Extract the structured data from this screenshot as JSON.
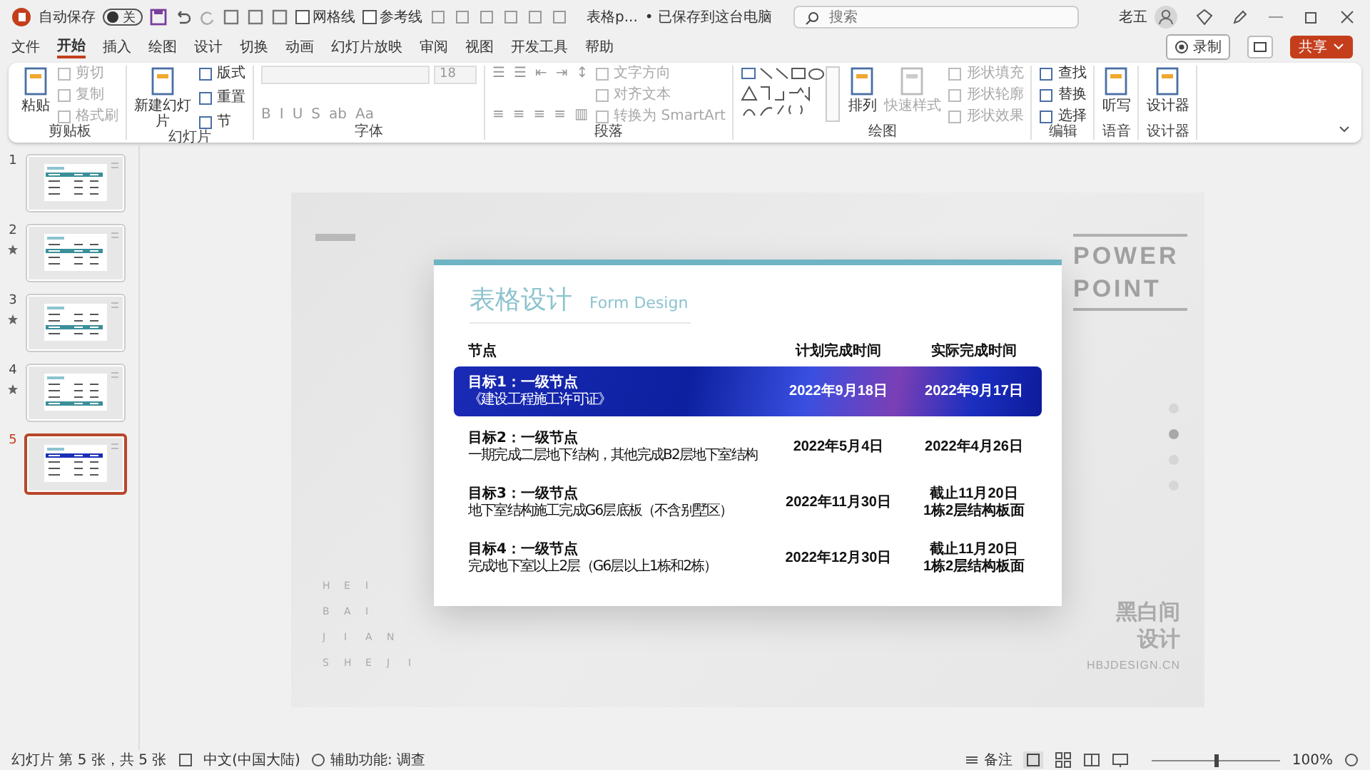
{
  "title_bar": {
    "autosave_label": "自动保存",
    "autosave_state": "关",
    "autosave_on": false,
    "quick_checks": [
      {
        "label": "网格线",
        "checked": false
      },
      {
        "label": "参考线",
        "checked": false
      }
    ],
    "file_name": "表格p...",
    "save_status": "• 已保存到这台电脑",
    "search": {
      "placeholder": "搜索"
    },
    "user_name": "老五"
  },
  "ribbon_tabs": [
    {
      "label": "文件",
      "selected": false
    },
    {
      "label": "开始",
      "selected": true
    },
    {
      "label": "插入",
      "selected": false
    },
    {
      "label": "绘图",
      "selected": false
    },
    {
      "label": "设计",
      "selected": false
    },
    {
      "label": "切换",
      "selected": false
    },
    {
      "label": "动画",
      "selected": false
    },
    {
      "label": "幻灯片放映",
      "selected": false
    },
    {
      "label": "审阅",
      "selected": false
    },
    {
      "label": "视图",
      "selected": false
    },
    {
      "label": "开发工具",
      "selected": false
    },
    {
      "label": "帮助",
      "selected": false
    }
  ],
  "top_actions": {
    "record": "录制",
    "share": "共享"
  },
  "ribbon_groups": [
    {
      "title": "剪贴板",
      "columns": [
        [
          {
            "kind": "large",
            "label": "粘贴",
            "disabled": false
          }
        ],
        [
          {
            "kind": "small",
            "label": "剪切",
            "disabled": true
          },
          {
            "kind": "small",
            "label": "复制",
            "disabled": true
          },
          {
            "kind": "small",
            "label": "格式刷",
            "disabled": true
          }
        ]
      ]
    },
    {
      "title": "幻灯片",
      "columns": [
        [
          {
            "kind": "large",
            "label": "新建幻灯片",
            "disabled": false
          }
        ],
        [
          {
            "kind": "small",
            "label": "版式",
            "disabled": false
          },
          {
            "kind": "small",
            "label": "重置",
            "disabled": false
          },
          {
            "kind": "small",
            "label": "节",
            "disabled": false
          }
        ]
      ]
    },
    {
      "title": "字体",
      "columns": [
        [
          {
            "kind": "combo",
            "label": "18",
            "disabled": true
          },
          {
            "kind": "glyphs",
            "labels": [
              "B",
              "I",
              "U",
              "S",
              "ab",
              "Aa"
            ],
            "disabled": true
          }
        ]
      ]
    },
    {
      "title": "段落",
      "columns": [
        [
          {
            "kind": "glyphs",
            "labels": [
              "☰",
              "☰",
              "⇤",
              "⇥",
              "↕"
            ],
            "disabled": true
          },
          {
            "kind": "glyphs",
            "labels": [
              "≡",
              "≡",
              "≡",
              "≡",
              "▥"
            ],
            "disabled": true
          }
        ],
        [
          {
            "kind": "small",
            "label": "文字方向",
            "disabled": true
          },
          {
            "kind": "small",
            "label": "对齐文本",
            "disabled": true
          },
          {
            "kind": "small",
            "label": "转换为 SmartArt",
            "disabled": true
          }
        ]
      ]
    },
    {
      "title": "绘图",
      "columns": [
        [
          {
            "kind": "shapes"
          }
        ],
        [
          {
            "kind": "large",
            "label": "排列",
            "disabled": false
          }
        ],
        [
          {
            "kind": "large",
            "label": "快速样式",
            "disabled": true
          }
        ],
        [
          {
            "kind": "small",
            "label": "形状填充",
            "disabled": true
          },
          {
            "kind": "small",
            "label": "形状轮廓",
            "disabled": true
          },
          {
            "kind": "small",
            "label": "形状效果",
            "disabled": true
          }
        ]
      ]
    },
    {
      "title": "编辑",
      "columns": [
        [
          {
            "kind": "small",
            "label": "查找",
            "disabled": false
          },
          {
            "kind": "small",
            "label": "替换",
            "disabled": false
          },
          {
            "kind": "small",
            "label": "选择",
            "disabled": false
          }
        ]
      ]
    },
    {
      "title": "语音",
      "columns": [
        [
          {
            "kind": "large",
            "label": "听写",
            "disabled": false
          }
        ]
      ]
    },
    {
      "title": "设计器",
      "columns": [
        [
          {
            "kind": "large",
            "label": "设计器",
            "disabled": false
          }
        ]
      ]
    }
  ],
  "slides": [
    {
      "number": "1",
      "selected": false,
      "animated": false
    },
    {
      "number": "2",
      "selected": false,
      "animated": true
    },
    {
      "number": "3",
      "selected": false,
      "animated": true
    },
    {
      "number": "4",
      "selected": false,
      "animated": true
    },
    {
      "number": "5",
      "selected": true,
      "animated": false
    }
  ],
  "slide": {
    "heading": "表格设计",
    "subheading": "Form Design",
    "columns": [
      "节点",
      "计划完成时间",
      "实际完成时间"
    ],
    "rows": [
      {
        "title": "目标1：一级节点",
        "detail": "《建设工程施工许可证》",
        "planned": "2022年9月18日",
        "actual": [
          "2022年9月17日"
        ],
        "highlighted": true
      },
      {
        "title": "目标2：一级节点",
        "detail": "一期完成二层地下结构，其他完成B2层地下室结构",
        "planned": "2022年5月4日",
        "actual": [
          "2022年4月26日"
        ],
        "highlighted": false
      },
      {
        "title": "目标3：一级节点",
        "detail": "地下室结构施工完成G6层底板（不含别墅区）",
        "planned": "2022年11月30日",
        "actual": [
          "截止11月20日",
          "1栋2层结构板面"
        ],
        "highlighted": false
      },
      {
        "title": "目标4：一级节点",
        "detail": "完成地下室以上2层（G6层以上1栋和2栋）",
        "planned": "2022年12月30日",
        "actual": [
          "截止11月20日",
          "1栋2层结构板面"
        ],
        "highlighted": false
      }
    ],
    "side_title": [
      "POWER",
      "POINT"
    ],
    "brand": [
      "黑白间",
      "设计"
    ],
    "site": "HBJDESIGN.CN",
    "letter_rows": [
      [
        "H",
        "E",
        "I"
      ],
      [
        "B",
        "A",
        "I"
      ],
      [
        "J",
        "I",
        "A",
        "N"
      ],
      [
        "S",
        "H",
        "E",
        "J",
        "I"
      ]
    ],
    "dots": [
      {
        "selected": false
      },
      {
        "selected": true
      },
      {
        "selected": false
      },
      {
        "selected": false
      }
    ]
  },
  "status_bar": {
    "slide_info": "幻灯片 第 5 张，共 5 张",
    "language": "中文(中国大陆)",
    "accessibility": "辅助功能: 调查",
    "notes": "备注",
    "zoom": "100%",
    "zoom_level": {
      "level": 0.5
    }
  }
}
